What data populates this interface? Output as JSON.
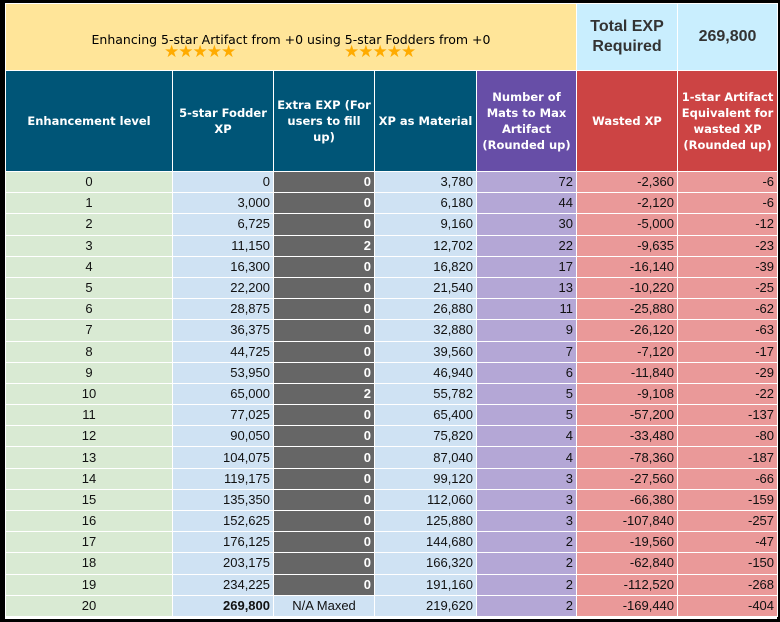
{
  "banner": {
    "title": "Enhancing 5-star Artifact from +0 using 5-star Fodders from +0",
    "artifact_stars": "★★★★★",
    "fodder_stars": "★★★★★",
    "total_label": "Total EXP Required",
    "total_value": "269,800"
  },
  "columns": [
    "Enhancement level",
    "5-star Fodder XP",
    "Extra EXP (For users to fill up)",
    "XP as Material",
    "Number of Mats to Max Artifact (Rounded up)",
    "Wasted XP",
    "1-star Artifact Equivalent for wasted XP (Rounded up)"
  ],
  "colors": {
    "title_bg": "#ffe599",
    "total_bg": "#c9eefe",
    "header_teal": "#005577",
    "header_purple": "#674ea7",
    "header_red": "#cc4444",
    "level_bg": "#d9ead3",
    "blue_bg": "#cfe2f3",
    "extra_bg": "#666666",
    "purple_bg": "#b4a7d6",
    "red_bg": "#ea9999",
    "star": "#ffab00"
  },
  "rows": [
    {
      "level": "0",
      "fodder_xp": "0",
      "extra": "0",
      "material": "3,780",
      "mats": "72",
      "wasted": "-2,360",
      "equiv": "-6"
    },
    {
      "level": "1",
      "fodder_xp": "3,000",
      "extra": "0",
      "material": "6,180",
      "mats": "44",
      "wasted": "-2,120",
      "equiv": "-6"
    },
    {
      "level": "2",
      "fodder_xp": "6,725",
      "extra": "0",
      "material": "9,160",
      "mats": "30",
      "wasted": "-5,000",
      "equiv": "-12"
    },
    {
      "level": "3",
      "fodder_xp": "11,150",
      "extra": "2",
      "material": "12,702",
      "mats": "22",
      "wasted": "-9,635",
      "equiv": "-23"
    },
    {
      "level": "4",
      "fodder_xp": "16,300",
      "extra": "0",
      "material": "16,820",
      "mats": "17",
      "wasted": "-16,140",
      "equiv": "-39"
    },
    {
      "level": "5",
      "fodder_xp": "22,200",
      "extra": "0",
      "material": "21,540",
      "mats": "13",
      "wasted": "-10,220",
      "equiv": "-25"
    },
    {
      "level": "6",
      "fodder_xp": "28,875",
      "extra": "0",
      "material": "26,880",
      "mats": "11",
      "wasted": "-25,880",
      "equiv": "-62"
    },
    {
      "level": "7",
      "fodder_xp": "36,375",
      "extra": "0",
      "material": "32,880",
      "mats": "9",
      "wasted": "-26,120",
      "equiv": "-63"
    },
    {
      "level": "8",
      "fodder_xp": "44,725",
      "extra": "0",
      "material": "39,560",
      "mats": "7",
      "wasted": "-7,120",
      "equiv": "-17"
    },
    {
      "level": "9",
      "fodder_xp": "53,950",
      "extra": "0",
      "material": "46,940",
      "mats": "6",
      "wasted": "-11,840",
      "equiv": "-29"
    },
    {
      "level": "10",
      "fodder_xp": "65,000",
      "extra": "2",
      "material": "55,782",
      "mats": "5",
      "wasted": "-9,108",
      "equiv": "-22"
    },
    {
      "level": "11",
      "fodder_xp": "77,025",
      "extra": "0",
      "material": "65,400",
      "mats": "5",
      "wasted": "-57,200",
      "equiv": "-137"
    },
    {
      "level": "12",
      "fodder_xp": "90,050",
      "extra": "0",
      "material": "75,820",
      "mats": "4",
      "wasted": "-33,480",
      "equiv": "-80"
    },
    {
      "level": "13",
      "fodder_xp": "104,075",
      "extra": "0",
      "material": "87,040",
      "mats": "4",
      "wasted": "-78,360",
      "equiv": "-187"
    },
    {
      "level": "14",
      "fodder_xp": "119,175",
      "extra": "0",
      "material": "99,120",
      "mats": "3",
      "wasted": "-27,560",
      "equiv": "-66"
    },
    {
      "level": "15",
      "fodder_xp": "135,350",
      "extra": "0",
      "material": "112,060",
      "mats": "3",
      "wasted": "-66,380",
      "equiv": "-159"
    },
    {
      "level": "16",
      "fodder_xp": "152,625",
      "extra": "0",
      "material": "125,880",
      "mats": "3",
      "wasted": "-107,840",
      "equiv": "-257"
    },
    {
      "level": "17",
      "fodder_xp": "176,125",
      "extra": "0",
      "material": "144,680",
      "mats": "2",
      "wasted": "-19,560",
      "equiv": "-47"
    },
    {
      "level": "18",
      "fodder_xp": "203,175",
      "extra": "0",
      "material": "166,320",
      "mats": "2",
      "wasted": "-62,840",
      "equiv": "-150"
    },
    {
      "level": "19",
      "fodder_xp": "234,225",
      "extra": "0",
      "material": "191,160",
      "mats": "2",
      "wasted": "-112,520",
      "equiv": "-268"
    },
    {
      "level": "20",
      "fodder_xp": "269,800",
      "extra": "N/A Maxed",
      "material": "219,620",
      "mats": "2",
      "wasted": "-169,440",
      "equiv": "-404"
    }
  ]
}
